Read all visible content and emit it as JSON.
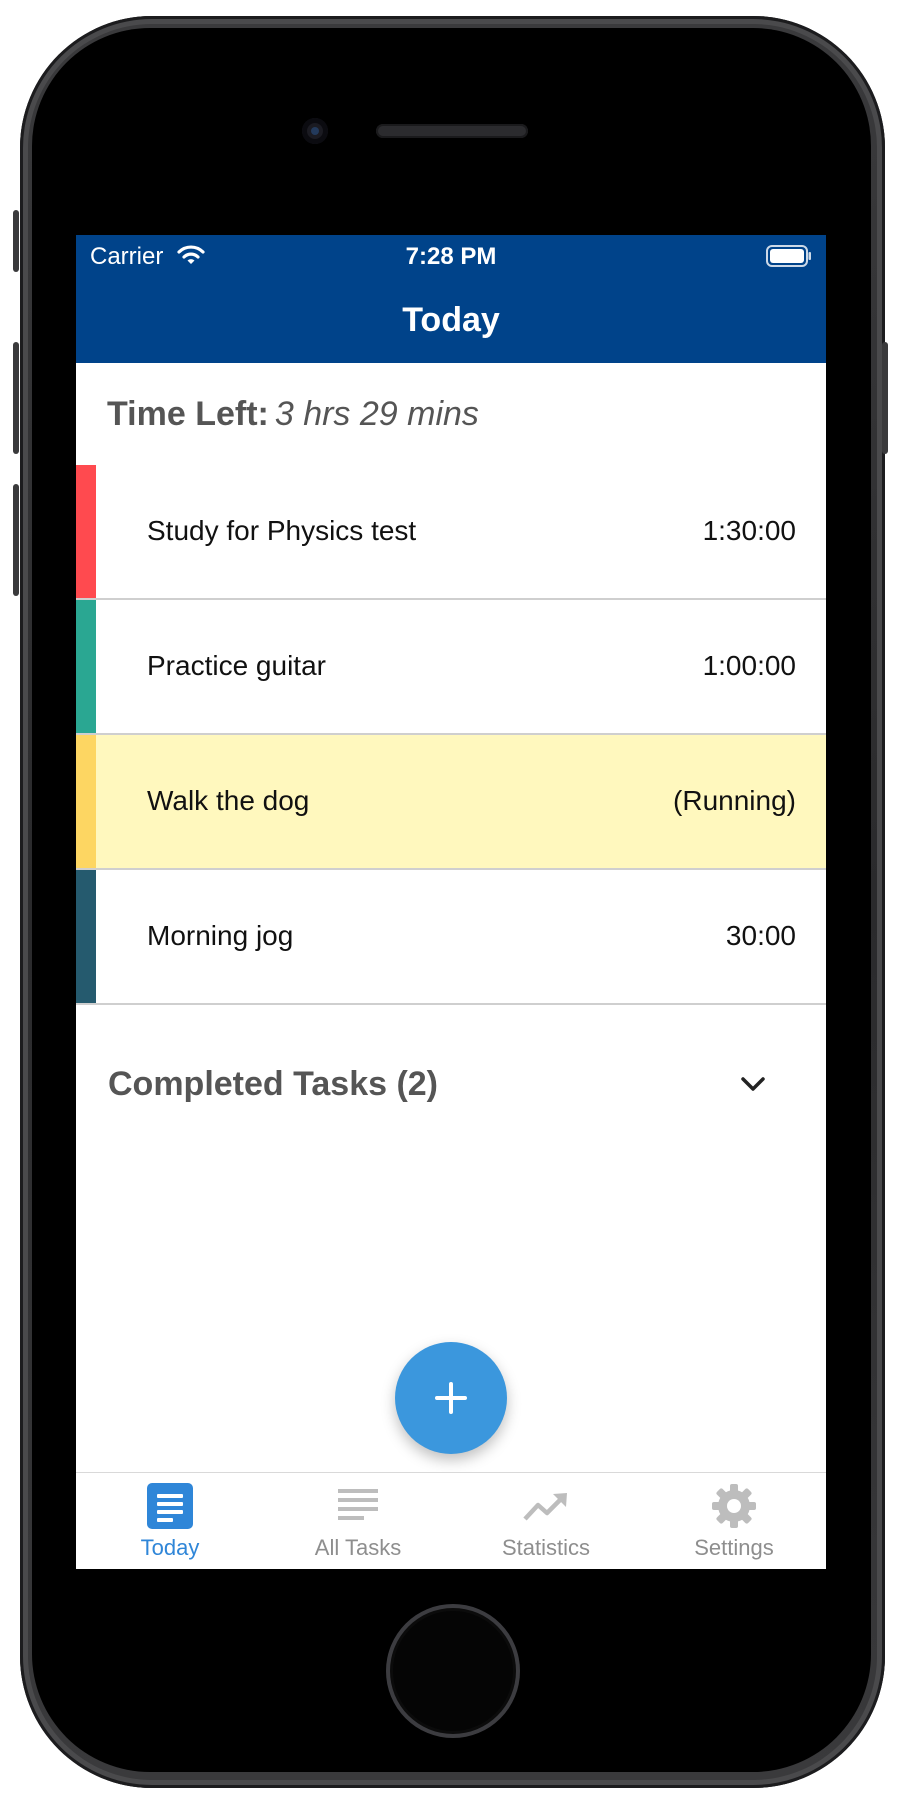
{
  "status_bar": {
    "carrier": "Carrier",
    "time": "7:28 PM"
  },
  "nav": {
    "title": "Today"
  },
  "time_left": {
    "label": "Time Left:",
    "value": "3 hrs 29 mins"
  },
  "tasks": [
    {
      "name": "Study for Physics test",
      "duration": "1:30:00",
      "color": "#ff4a4f",
      "running": false
    },
    {
      "name": "Practice guitar",
      "duration": "1:00:00",
      "color": "#2aa792",
      "running": false
    },
    {
      "name": "Walk the dog",
      "duration": "(Running)",
      "color": "#fdd662",
      "running": true
    },
    {
      "name": "Morning jog",
      "duration": "30:00",
      "color": "#255a6e",
      "running": false
    }
  ],
  "completed": {
    "label": "Completed Tasks (2)"
  },
  "fab": {
    "icon": "plus-icon"
  },
  "tab_bar": {
    "tabs": [
      {
        "label": "Today",
        "icon": "today-list-icon",
        "active": true
      },
      {
        "label": "All Tasks",
        "icon": "list-lines-icon",
        "active": false
      },
      {
        "label": "Statistics",
        "icon": "trend-up-icon",
        "active": false
      },
      {
        "label": "Settings",
        "icon": "gear-icon",
        "active": false
      }
    ]
  },
  "colors": {
    "nav_background": "#00438a",
    "accent": "#3b97dd",
    "running_background": "#fff8be",
    "active_tab": "#2f86d8",
    "inactive_tab": "#8e8e8e"
  }
}
